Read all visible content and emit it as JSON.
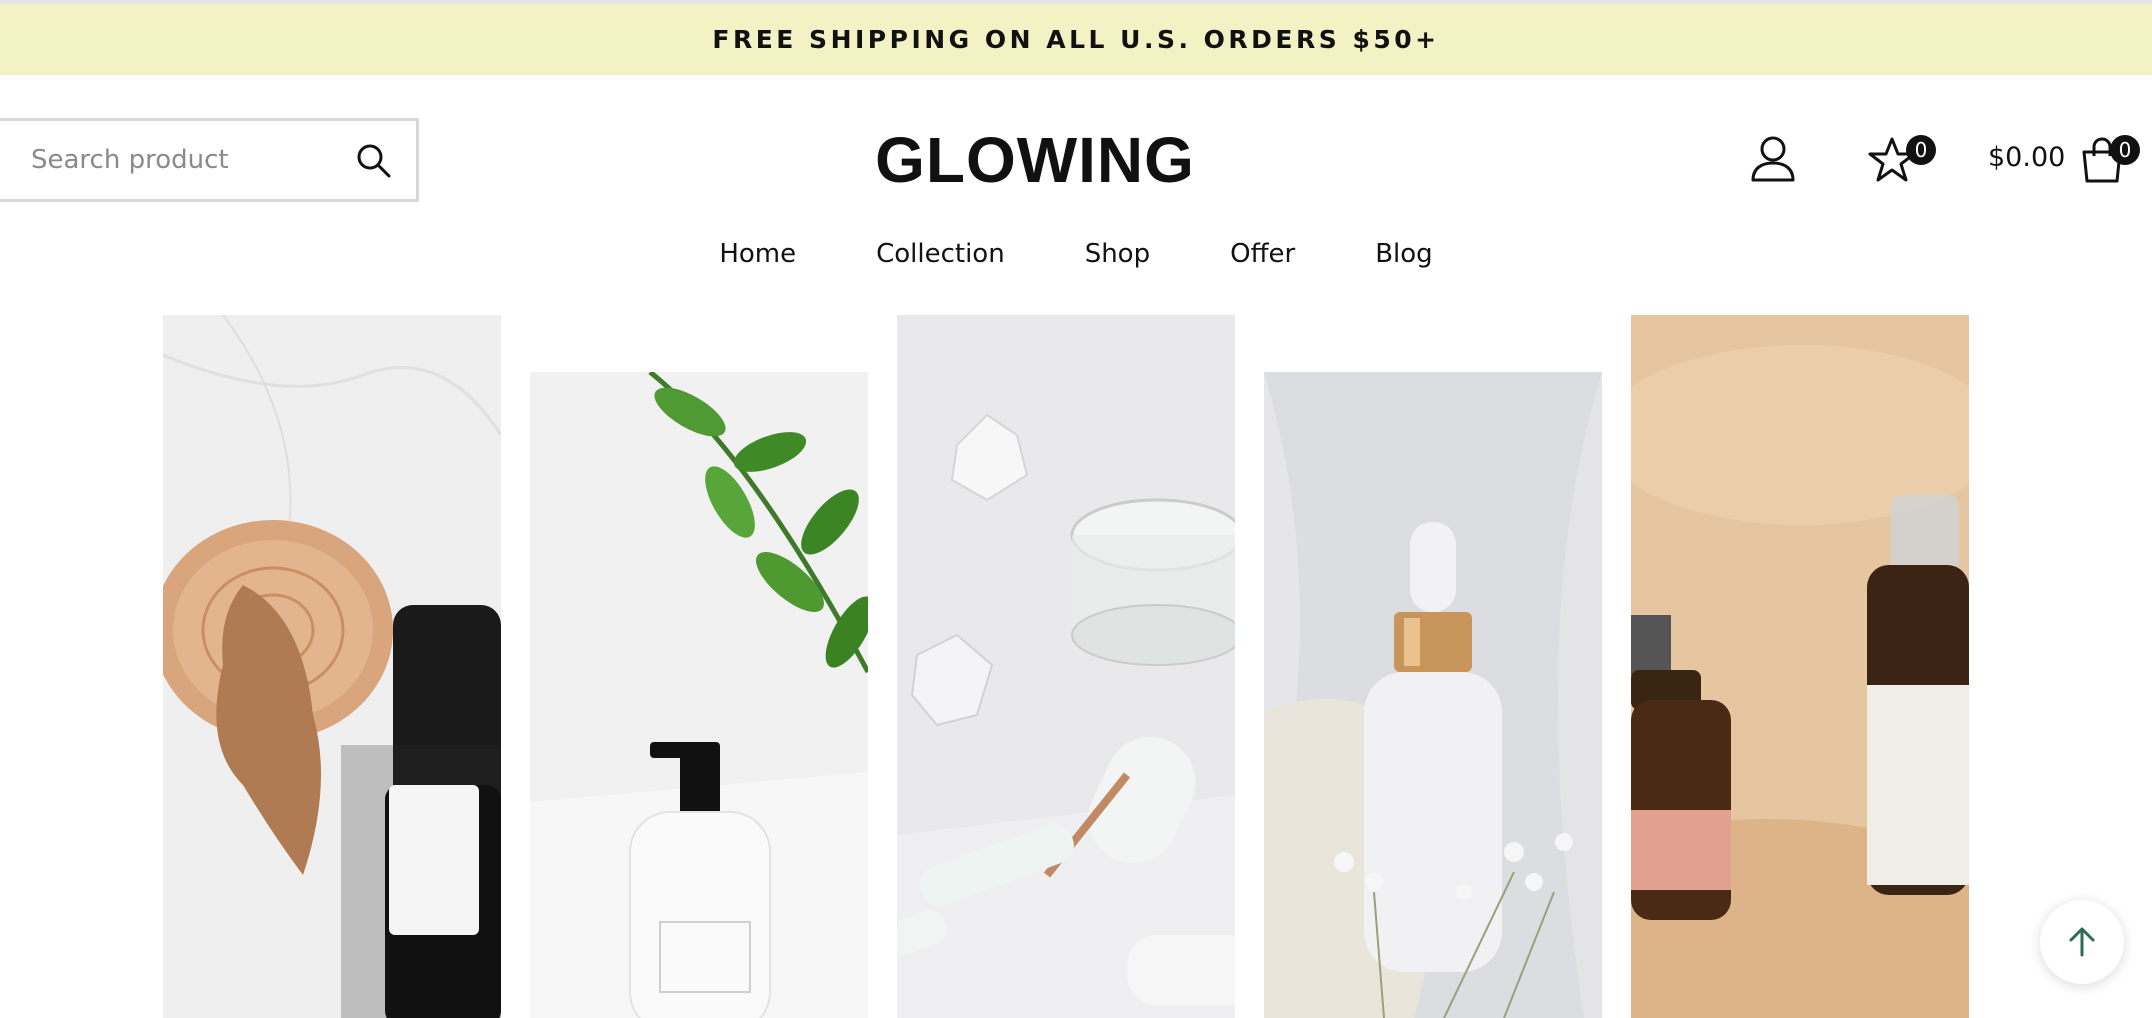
{
  "announcement": {
    "text": "FREE SHIPPING ON ALL U.S. ORDERS $50+"
  },
  "search": {
    "placeholder": "Search product",
    "value": ""
  },
  "brand": {
    "logo": "GLOWING"
  },
  "header": {
    "wishlist_count": "0",
    "cart_total": "$0.00",
    "cart_count": "0",
    "icons": [
      "search-icon",
      "user-icon",
      "star-icon",
      "shopping-bag-icon",
      "arrow-up-icon"
    ]
  },
  "nav": {
    "items": [
      {
        "label": "Home"
      },
      {
        "label": "Collection"
      },
      {
        "label": "Shop"
      },
      {
        "label": "Offer"
      },
      {
        "label": "Blog"
      }
    ]
  },
  "colors": {
    "announcement_bg": "#f3f2c5",
    "text": "#111111",
    "scroll_arrow": "#2e6b55"
  }
}
